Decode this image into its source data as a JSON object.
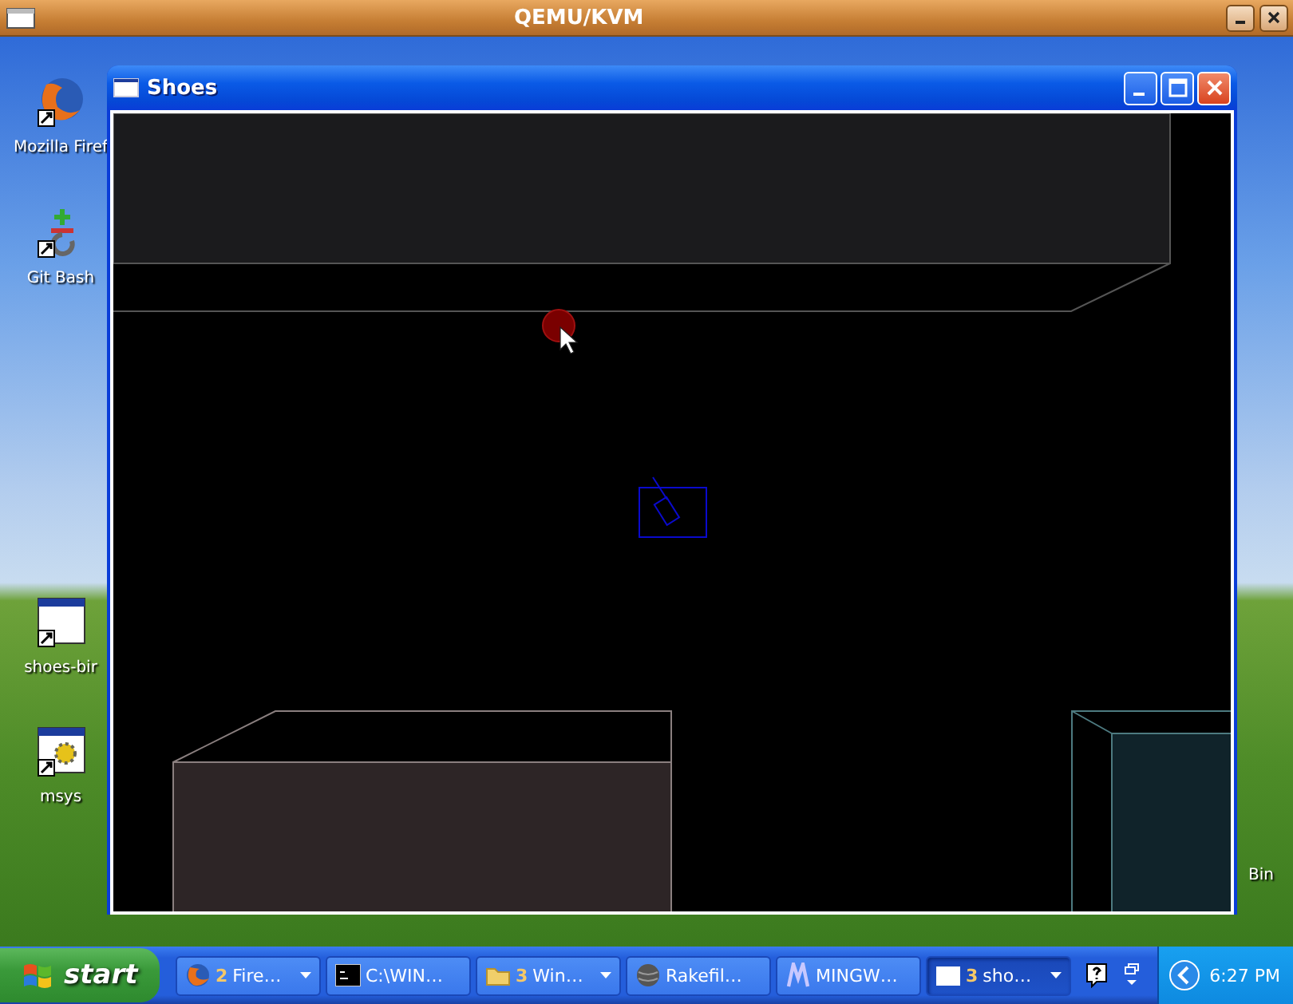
{
  "host_window": {
    "title": "QEMU/KVM"
  },
  "desktop_icons": [
    {
      "label": "Mozilla Firef",
      "kind": "firefox"
    },
    {
      "label": "Git Bash",
      "kind": "git"
    },
    {
      "label": "shoes-bir",
      "kind": "window"
    },
    {
      "label": "msys",
      "kind": "gear-window"
    },
    {
      "label": "Bin",
      "kind": "hidden"
    }
  ],
  "app_window": {
    "title": "Shoes"
  },
  "taskbar": {
    "start": "start",
    "tasks": [
      {
        "count": "2",
        "label": "Fire…",
        "kind": "firefox",
        "grouped": true,
        "selected": false
      },
      {
        "label": "C:\\WIN…",
        "kind": "console",
        "grouped": false,
        "selected": false
      },
      {
        "count": "3",
        "label": "Win…",
        "kind": "folder",
        "grouped": true,
        "selected": false
      },
      {
        "label": "Rakefil…",
        "kind": "ball",
        "grouped": false,
        "selected": false
      },
      {
        "label": "MINGW…",
        "kind": "mingw",
        "grouped": false,
        "selected": false
      },
      {
        "count": "3",
        "label": "sho…",
        "kind": "window",
        "grouped": true,
        "selected": true
      }
    ],
    "clock": "6:27 PM"
  }
}
